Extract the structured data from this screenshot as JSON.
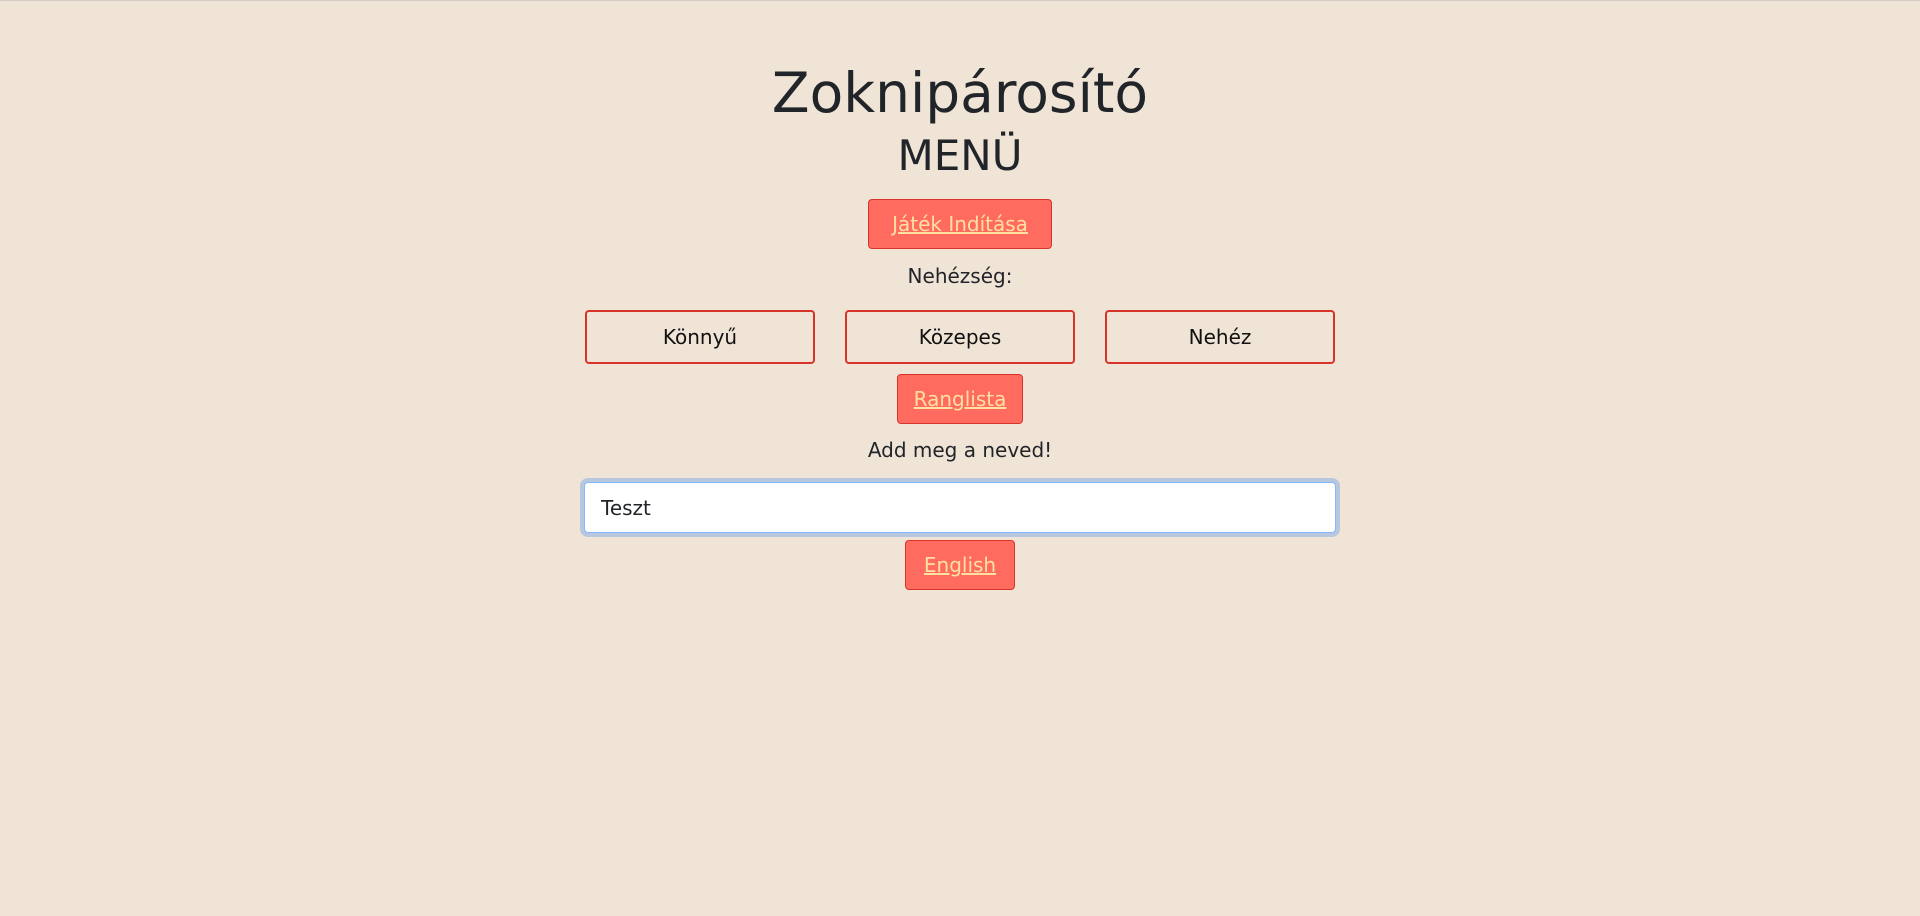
{
  "header": {
    "title": "Zoknipárosító",
    "subtitle": "MENÜ"
  },
  "menu": {
    "start_label": "Játék Indítása",
    "difficulty_label": "Nehézség:",
    "difficulties": [
      "Könnyű",
      "Közepes",
      "Nehéz"
    ],
    "leaderboard_label": "Ranglista",
    "name_prompt": "Add meg a neved!",
    "name_value": "Teszt",
    "language_label": "English"
  },
  "colors": {
    "background": "#f0e4d7",
    "button_bg": "#ff6b5f",
    "button_border": "#d9342b",
    "button_text": "#ffe0a0"
  }
}
